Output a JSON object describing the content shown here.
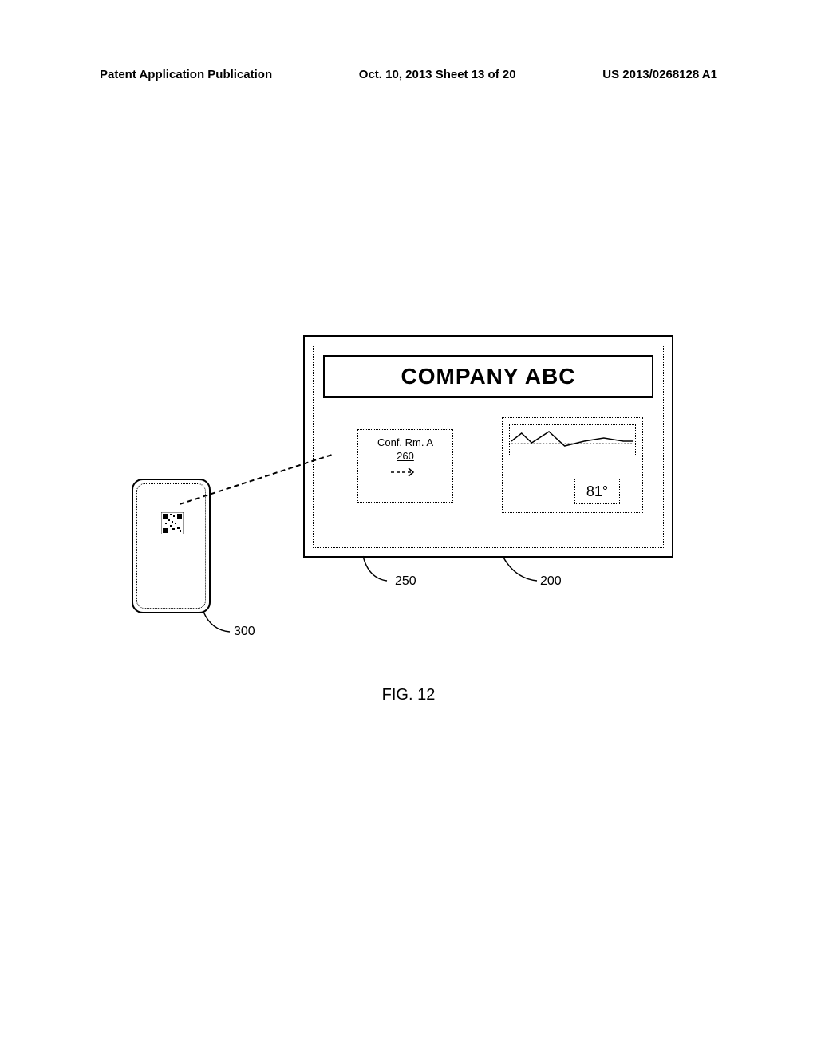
{
  "header": {
    "left": "Patent Application Publication",
    "center": "Oct. 10, 2013  Sheet 13 of 20",
    "right": "US 2013/0268128 A1"
  },
  "panel": {
    "company": "COMPANY ABC",
    "room": {
      "name": "Conf. Rm. A",
      "number": "260"
    },
    "temperature": "81°"
  },
  "callouts": {
    "c200": "200",
    "c250": "250",
    "c300": "300"
  },
  "figure_label": "FIG. 12"
}
